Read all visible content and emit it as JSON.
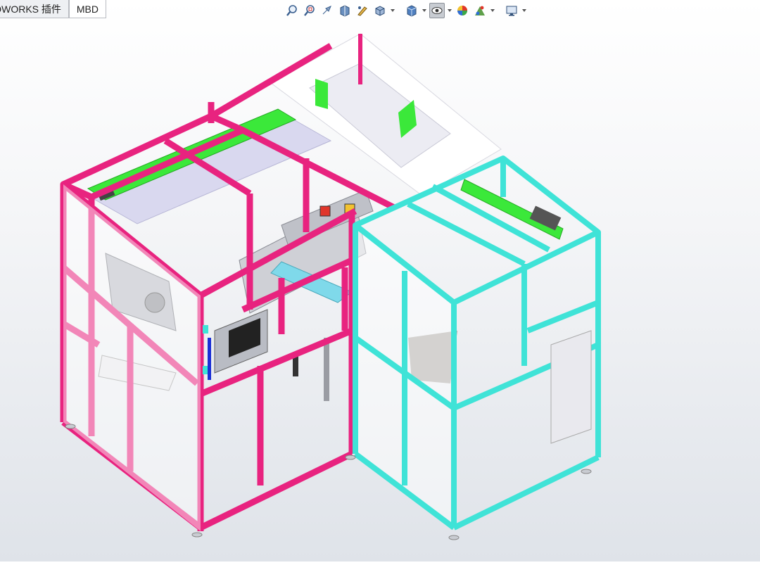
{
  "tabs": [
    {
      "label": "DWORKS 插件",
      "active": false
    },
    {
      "label": "MBD",
      "active": true
    }
  ],
  "heads_up_toolbar": {
    "icons": [
      "zoom-to-fit-icon",
      "zoom-to-area-icon",
      "previous-view-icon",
      "section-view-icon",
      "dynamic-annotation-view-icon",
      "view-orientation-icon",
      "display-style-icon",
      "hide-show-items-icon",
      "edit-appearance-icon",
      "apply-scene-icon",
      "view-settings-icon"
    ]
  },
  "colors": {
    "main_frame": "#e8237f",
    "second_frame": "#3fe3d7",
    "conveyor_green": "#3be83a",
    "panel_lavender": "#d9d8ef",
    "background_top": "#ffffff",
    "background_bottom": "#dfe3e9"
  }
}
